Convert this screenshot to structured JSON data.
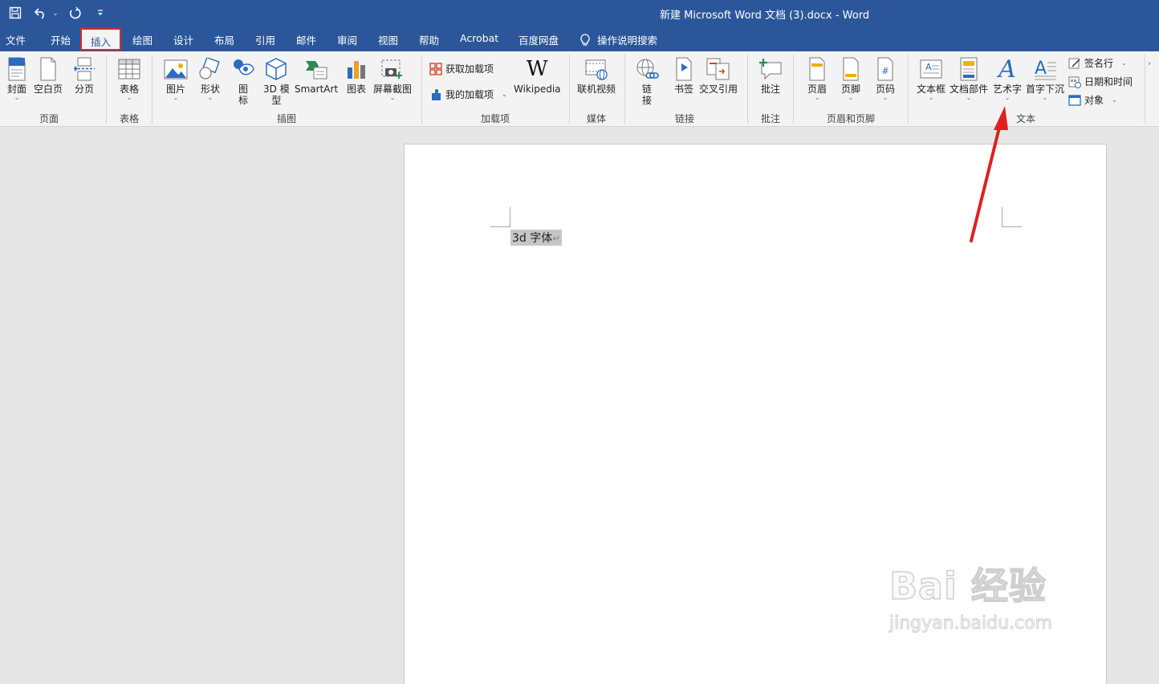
{
  "title_bar": {
    "title": "新建 Microsoft Word 文档 (3).docx  -  Word"
  },
  "quick_access": [
    "save-icon",
    "undo-icon",
    "redo-icon",
    "customize-icon"
  ],
  "tabs": [
    "文件",
    "开始",
    "插入",
    "绘图",
    "设计",
    "布局",
    "引用",
    "邮件",
    "审阅",
    "视图",
    "帮助",
    "Acrobat",
    "百度网盘"
  ],
  "active_tab": "插入",
  "tell_me": "操作说明搜索",
  "ribbon": {
    "groups": {
      "pages": "页面",
      "tables": "表格",
      "illustrations": "插图",
      "addins": "加载项",
      "media": "媒体",
      "links": "链接",
      "comments": "批注",
      "header_footer": "页眉和页脚",
      "text": "文本"
    },
    "buttons": {
      "cover": "封面",
      "blank_page": "空白页",
      "page_break": "分页",
      "table": "表格",
      "pictures": "图片",
      "shapes": "形状",
      "icons_1": "图",
      "icons_2": "标",
      "model_1": "3D 模",
      "model_2": "型",
      "smartart": "SmartArt",
      "chart": "图表",
      "screenshot": "屏幕截图",
      "get_addins": "获取加载项",
      "my_addins": "我的加载项",
      "wikipedia": "Wikipedia",
      "online_video": "联机视频",
      "link_1": "链",
      "link_2": "接",
      "bookmark": "书签",
      "cross_ref": "交叉引用",
      "comment": "批注",
      "header": "页眉",
      "footer": "页脚",
      "page_number": "页码",
      "textbox": "文本框",
      "quick_parts": "文档部件",
      "wordart": "艺术字",
      "drop_cap": "首字下沉",
      "signature_line": "签名行",
      "date_time": "日期和时间",
      "object": "对象"
    }
  },
  "document": {
    "text": "3d 字体",
    "paragraph_mark": "↵"
  },
  "watermark": {
    "line1": "Bai 经验",
    "line2": "jingyan.baidu.com"
  },
  "colors": {
    "titlebar": "#2b579a",
    "ribbon": "#f3f3f3",
    "highlight_box": "#d92b2b",
    "arrow": "#e02020"
  }
}
